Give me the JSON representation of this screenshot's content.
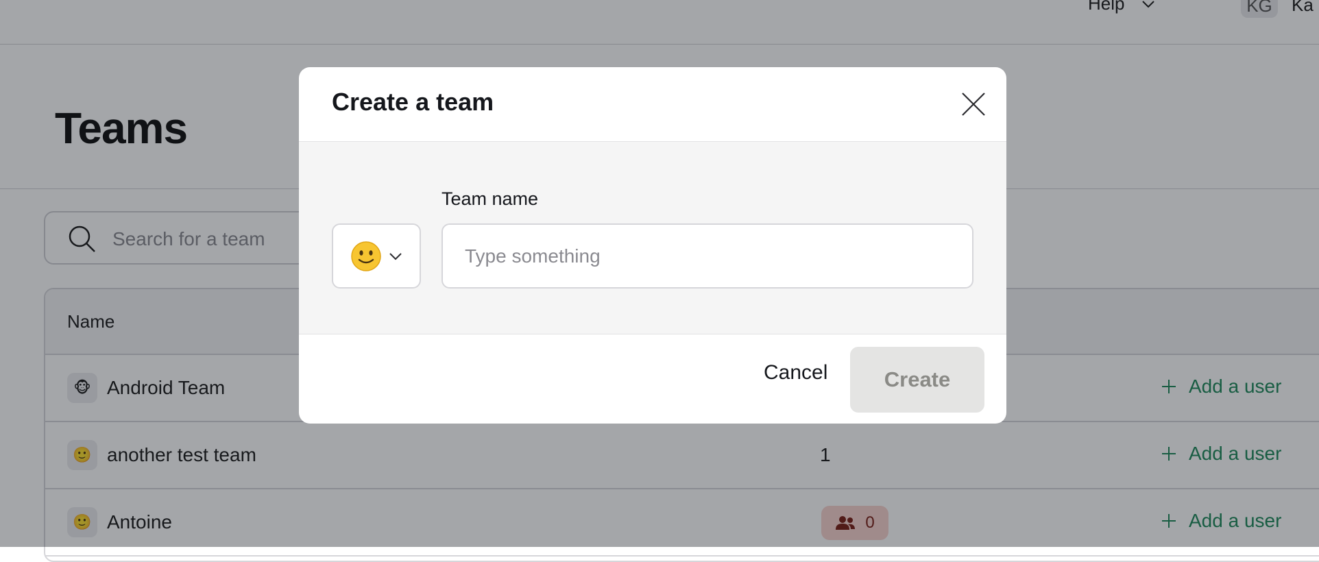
{
  "topbar": {
    "help_label": "Help",
    "avatar_initials": "KG",
    "user_name_fragment": "Ka"
  },
  "page": {
    "title": "Teams"
  },
  "search": {
    "placeholder": "Search for a team"
  },
  "table": {
    "columns": {
      "name": "Name"
    },
    "rows": [
      {
        "emoji": "🐵",
        "name": "Android Team",
        "members": "",
        "action": "Add a user"
      },
      {
        "emoji": "🙂",
        "name": "another test team",
        "members": "1",
        "action": "Add a user"
      },
      {
        "emoji": "🙂",
        "name": "Antoine",
        "members": "0",
        "action": "Add a user"
      }
    ]
  },
  "modal": {
    "title": "Create a team",
    "emoji": "🙂",
    "field_label": "Team name",
    "input_placeholder": "Type something",
    "input_value": "",
    "cancel_label": "Cancel",
    "create_label": "Create",
    "create_disabled": true
  },
  "colors": {
    "accent_green": "#1f8a5b",
    "overlay": "#11141e",
    "badge_bg": "#f9d3cf"
  }
}
